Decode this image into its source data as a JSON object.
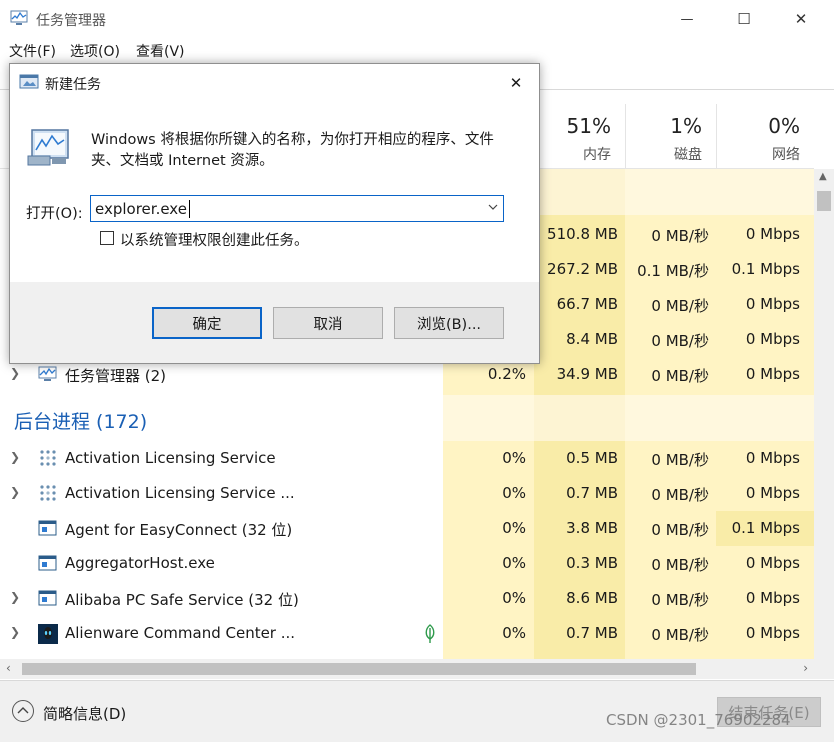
{
  "window": {
    "title": "任务管理器",
    "min_glyph": "—",
    "max_glyph": "☐",
    "close_glyph": "✕"
  },
  "menu": {
    "file": "文件(F)",
    "options": "选项(O)",
    "view": "查看(V)"
  },
  "columns": [
    {
      "pct": "51%",
      "label": "内存"
    },
    {
      "pct": "1%",
      "label": "磁盘"
    },
    {
      "pct": "0%",
      "label": "网络"
    }
  ],
  "apps_rows": [
    {
      "cpu": "",
      "mem": "510.8 MB",
      "disk": "0 MB/秒",
      "net": "0 Mbps"
    },
    {
      "cpu": "",
      "mem": "267.2 MB",
      "disk": "0.1 MB/秒",
      "net": "0.1 Mbps"
    },
    {
      "cpu": "",
      "mem": "66.7 MB",
      "disk": "0 MB/秒",
      "net": "0 Mbps"
    },
    {
      "cpu": "",
      "mem": "8.4 MB",
      "disk": "0 MB/秒",
      "net": "0 Mbps"
    },
    {
      "name": "任务管理器 (2)",
      "cpu": "0.2%",
      "mem": "34.9 MB",
      "disk": "0 MB/秒",
      "net": "0 Mbps"
    }
  ],
  "background_group": "后台进程 (172)",
  "background_rows": [
    {
      "name": "Activation Licensing Service",
      "cpu": "0%",
      "mem": "0.5 MB",
      "disk": "0 MB/秒",
      "net": "0 Mbps"
    },
    {
      "name": "Activation Licensing Service ...",
      "cpu": "0%",
      "mem": "0.7 MB",
      "disk": "0 MB/秒",
      "net": "0 Mbps"
    },
    {
      "name": "Agent for EasyConnect (32 位)",
      "cpu": "0%",
      "mem": "3.8 MB",
      "disk": "0 MB/秒",
      "net": "0.1 Mbps"
    },
    {
      "name": "AggregatorHost.exe",
      "cpu": "0%",
      "mem": "0.3 MB",
      "disk": "0 MB/秒",
      "net": "0 Mbps"
    },
    {
      "name": "Alibaba PC Safe Service (32 位)",
      "cpu": "0%",
      "mem": "8.6 MB",
      "disk": "0 MB/秒",
      "net": "0 Mbps"
    },
    {
      "name": "Alienware Command Center ...",
      "cpu": "0%",
      "mem": "0.7 MB",
      "disk": "0 MB/秒",
      "net": "0 Mbps"
    }
  ],
  "footer": {
    "fewer_details": "简略信息(D)",
    "end_task": "结束任务(E)",
    "watermark": "CSDN @2301_76902284"
  },
  "dialog": {
    "title": "新建任务",
    "close_glyph": "✕",
    "description": "Windows 将根据你所键入的名称，为你打开相应的程序、文件夹、文档或 Internet 资源。",
    "open_label": "打开(O):",
    "open_value": "explorer.exe",
    "admin_label": "以系统管理权限创建此任务。",
    "ok": "确定",
    "cancel": "取消",
    "browse": "浏览(B)..."
  },
  "colors": {
    "heat_light": "#fff4c4",
    "heat_mid": "#f9eca8",
    "group_blue": "#1a5fb4",
    "accent": "#0a64c8"
  }
}
